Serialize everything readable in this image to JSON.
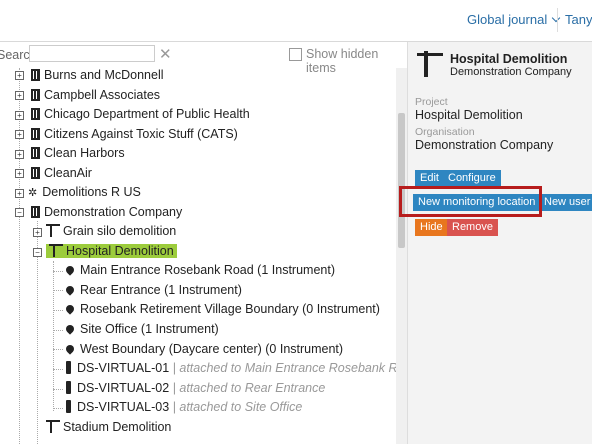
{
  "header": {
    "journal_label": "Global journal",
    "user_label": "Tanya"
  },
  "toolbar": {
    "search_label": "Search",
    "search_value": "",
    "clear_symbol": "✕",
    "show_hidden_label": "Show hidden items"
  },
  "tree": {
    "items": [
      {
        "label": "Burns and McDonnell",
        "icon": "building-icon"
      },
      {
        "label": "Campbell Associates",
        "icon": "building-icon"
      },
      {
        "label": "Chicago Department of Public Health",
        "icon": "building-icon"
      },
      {
        "label": "Citizens Against Toxic Stuff (CATS)",
        "icon": "building-icon"
      },
      {
        "label": "Clean Harbors",
        "icon": "building-icon"
      },
      {
        "label": "CleanAir",
        "icon": "building-icon"
      },
      {
        "label": "Demolitions R US",
        "icon": "network-icon"
      },
      {
        "label": "Demonstration Company",
        "icon": "building-icon"
      },
      {
        "label": "Grain silo demolition",
        "icon": "crane-icon"
      },
      {
        "label": "Hospital Demolition",
        "icon": "crane-icon"
      },
      {
        "label": "Main Entrance Rosebank Road (1 Instrument)",
        "icon": "location-pin-icon"
      },
      {
        "label": "Rear Entrance (1 Instrument)",
        "icon": "location-pin-icon"
      },
      {
        "label": "Rosebank Retirement Village Boundary (0 Instrument)",
        "icon": "location-pin-icon"
      },
      {
        "label": "Site Office (1 Instrument)",
        "icon": "location-pin-icon"
      },
      {
        "label": "West Boundary (Daycare center) (0 Instrument)",
        "icon": "location-pin-icon"
      },
      {
        "label": "DS-VIRTUAL-01",
        "attached": "| attached to Main Entrance Rosebank Road",
        "icon": "device-icon"
      },
      {
        "label": "DS-VIRTUAL-02",
        "attached": "| attached to Rear Entrance",
        "icon": "device-icon"
      },
      {
        "label": "DS-VIRTUAL-03",
        "attached": "| attached to Site Office",
        "icon": "device-icon"
      },
      {
        "label": "Stadium Demolition",
        "icon": "crane-icon"
      }
    ],
    "expander_plus": "+",
    "expander_minus": "−"
  },
  "detail": {
    "title": "Hospital Demolition",
    "subtitle": "Demonstration Company",
    "project_label": "Project",
    "project_value": "Hospital Demolition",
    "organisation_label": "Organisation",
    "organisation_value": "Demonstration Company",
    "buttons": {
      "edit": "Edit",
      "configure": "Configure",
      "new_monitoring_location": "New monitoring location",
      "new_user": "New user",
      "hide": "Hide",
      "remove": "Remove"
    }
  },
  "colors": {
    "accent_blue": "#2e86c1",
    "highlight_green": "#9ccc3c",
    "annotation_red": "#b71c1c",
    "hide_orange": "#e8761e",
    "remove_red": "#d9534f"
  }
}
